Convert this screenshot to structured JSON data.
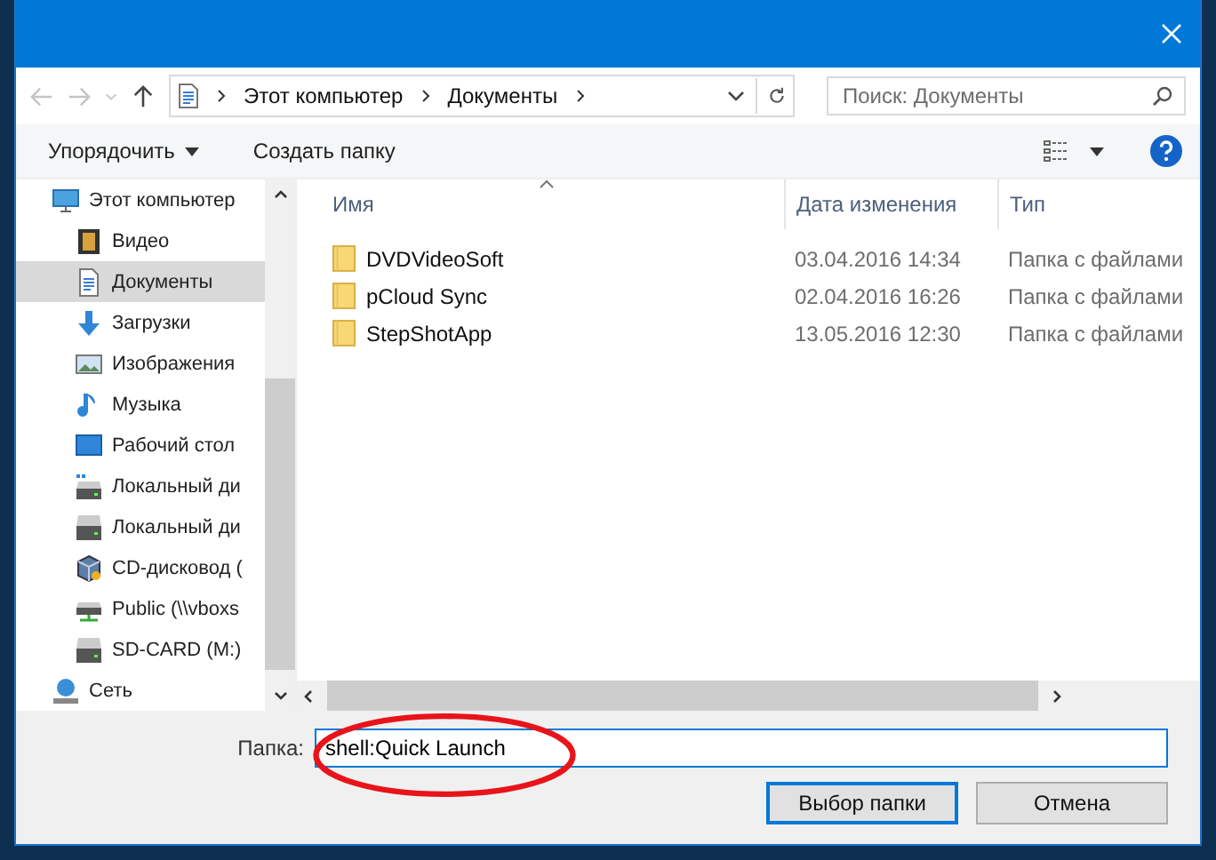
{
  "address_bar": {
    "path": [
      "Этот компьютер",
      "Документы"
    ]
  },
  "search": {
    "placeholder": "Поиск: Документы"
  },
  "toolbar": {
    "organize": "Упорядочить",
    "new_folder": "Создать папку"
  },
  "navigation": {
    "items": [
      {
        "label": "Этот компьютер",
        "kind": "computer",
        "selected": false,
        "children": [
          {
            "label": "Видео",
            "kind": "video",
            "selected": false
          },
          {
            "label": "Документы",
            "kind": "documents",
            "selected": true
          },
          {
            "label": "Загрузки",
            "kind": "downloads",
            "selected": false
          },
          {
            "label": "Изображения",
            "kind": "pictures",
            "selected": false
          },
          {
            "label": "Музыка",
            "kind": "music",
            "selected": false
          },
          {
            "label": "Рабочий стол",
            "kind": "desktop",
            "selected": false
          },
          {
            "label": "Локальный ди",
            "kind": "system-drive",
            "selected": false
          },
          {
            "label": "Локальный ди",
            "kind": "drive",
            "selected": false
          },
          {
            "label": "CD-дисковод (",
            "kind": "cd",
            "selected": false
          },
          {
            "label": "Public (\\\\vboxs",
            "kind": "network-drive",
            "selected": false
          },
          {
            "label": "SD-CARD (M:)",
            "kind": "drive",
            "selected": false
          }
        ]
      },
      {
        "label": "Сеть",
        "kind": "network",
        "selected": false
      }
    ]
  },
  "table": {
    "columns": [
      "Имя",
      "Дата изменения",
      "Тип"
    ],
    "rows": [
      {
        "name": "DVDVideoSoft",
        "date": "03.04.2016 14:34",
        "type": "Папка с файлами"
      },
      {
        "name": "pCloud Sync",
        "date": "02.04.2016 16:26",
        "type": "Папка с файлами"
      },
      {
        "name": "StepShotApp",
        "date": "13.05.2016 12:30",
        "type": "Папка с файлами"
      }
    ]
  },
  "folder_field": {
    "label": "Папка:",
    "value": "shell:Quick Launch"
  },
  "buttons": [
    "Выбор папки",
    "Отмена"
  ]
}
